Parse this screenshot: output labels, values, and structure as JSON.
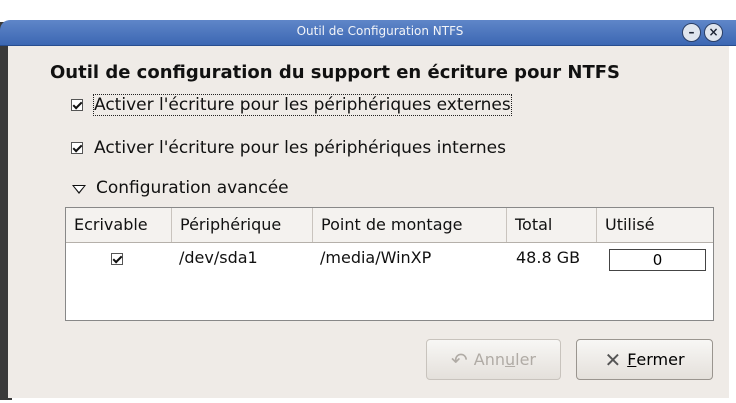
{
  "window": {
    "title": "Outil de Configuration NTFS",
    "controls": {
      "minimize": "–",
      "close": "×"
    }
  },
  "main": {
    "heading": "Outil de configuration du support en écriture pour NTFS",
    "options": [
      {
        "label": "Activer l'écriture pour les périphériques externes",
        "checked": true
      },
      {
        "label": "Activer l'écriture pour les périphériques internes",
        "checked": true
      }
    ],
    "advanced": {
      "label": "Configuration avancée",
      "expanded": true
    },
    "table": {
      "columns": [
        "Ecrivable",
        "Périphérique",
        "Point de montage",
        "Total",
        "Utilisé"
      ],
      "rows": [
        {
          "writable": true,
          "device": "/dev/sda1",
          "mount": "/media/WinXP",
          "total": "48.8 GB",
          "used": "0"
        }
      ]
    }
  },
  "buttons": {
    "cancel": {
      "pre": "Ann",
      "ul": "u",
      "post": "ler",
      "enabled": false
    },
    "close": {
      "pre": "",
      "ul": "F",
      "post": "ermer",
      "enabled": true
    }
  },
  "icons": {
    "cancel": "undo-arrow-icon",
    "close": "x-icon"
  }
}
